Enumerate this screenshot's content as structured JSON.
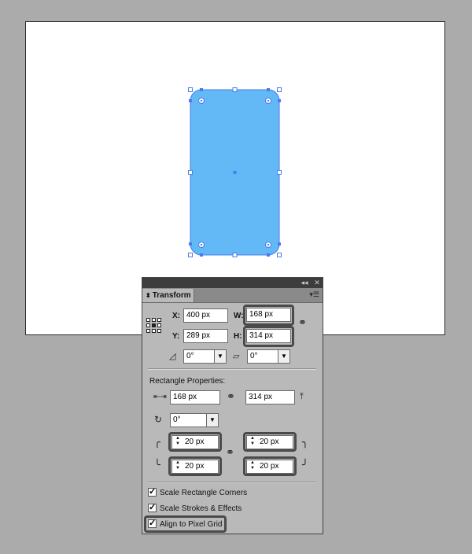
{
  "panel": {
    "collapse_icon": "double-chevron-left",
    "close_icon": "close",
    "tab": {
      "arrows": "⬍",
      "label": "Transform"
    },
    "menu_icon": "panel-menu",
    "x": {
      "label": "X:",
      "value": "400 px"
    },
    "y": {
      "label": "Y:",
      "value": "289 px"
    },
    "w": {
      "label": "W:",
      "value": "168 px"
    },
    "h": {
      "label": "H:",
      "value": "314 px"
    },
    "rotate": {
      "value": "0°"
    },
    "shear": {
      "value": "0°"
    },
    "rect": {
      "title": "Rectangle Properties:",
      "width": "168 px",
      "height": "314 px",
      "rotation": "0°",
      "corner_tl": "20 px",
      "corner_tr": "20 px",
      "corner_bl": "20 px",
      "corner_br": "20 px"
    },
    "checkboxes": [
      {
        "label": "Scale Rectangle Corners",
        "checked": true
      },
      {
        "label": "Scale Strokes & Effects",
        "checked": true
      },
      {
        "label": "Align to Pixel Grid",
        "checked": true
      }
    ]
  },
  "colors": {
    "shape_fill": "#62b9f5",
    "selection": "#4a7bf0",
    "canvas_bg": "#ababab"
  }
}
